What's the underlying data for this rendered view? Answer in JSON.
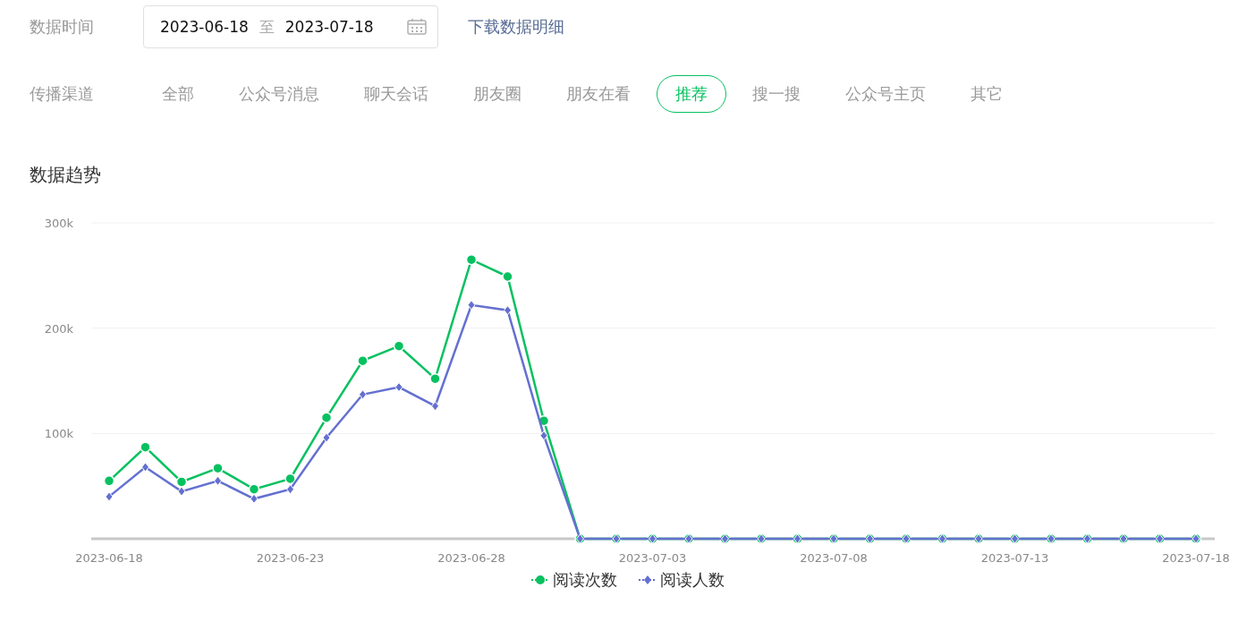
{
  "date_filter": {
    "label": "数据时间",
    "start": "2023-06-18",
    "separator": "至",
    "end": "2023-07-18",
    "download_link": "下载数据明细"
  },
  "channels": {
    "label": "传播渠道",
    "tabs": [
      {
        "label": "全部",
        "selected": false
      },
      {
        "label": "公众号消息",
        "selected": false
      },
      {
        "label": "聊天会话",
        "selected": false
      },
      {
        "label": "朋友圈",
        "selected": false
      },
      {
        "label": "朋友在看",
        "selected": false
      },
      {
        "label": "推荐",
        "selected": true
      },
      {
        "label": "搜一搜",
        "selected": false
      },
      {
        "label": "公众号主页",
        "selected": false
      },
      {
        "label": "其它",
        "selected": false
      }
    ]
  },
  "trend": {
    "title": "数据趋势",
    "chart_data": {
      "type": "line",
      "categories": [
        "2023-06-18",
        null,
        null,
        null,
        null,
        "2023-06-23",
        null,
        null,
        null,
        null,
        "2023-06-28",
        null,
        null,
        null,
        null,
        "2023-07-03",
        null,
        null,
        null,
        null,
        "2023-07-08",
        null,
        null,
        null,
        null,
        "2023-07-13",
        null,
        null,
        null,
        null,
        "2023-07-18"
      ],
      "legend": "bottom",
      "ylim": [
        0,
        300000
      ],
      "yticks": [
        {
          "value": 100000,
          "label": "100k"
        },
        {
          "value": 200000,
          "label": "200k"
        },
        {
          "value": 300000,
          "label": "300k"
        }
      ],
      "series": [
        {
          "name": "阅读次数",
          "color": "#07c160",
          "marker": "circle",
          "values": [
            55000,
            87000,
            54000,
            67000,
            47000,
            57000,
            115000,
            169000,
            183000,
            152000,
            265000,
            249000,
            112000,
            0,
            0,
            0,
            0,
            0,
            0,
            0,
            0,
            0,
            0,
            0,
            0,
            0,
            0,
            0,
            0,
            0,
            0
          ]
        },
        {
          "name": "阅读人数",
          "color": "#6470d0",
          "marker": "diamond",
          "values": [
            40000,
            68000,
            45000,
            55000,
            38000,
            47000,
            96000,
            137000,
            144000,
            126000,
            222000,
            217000,
            98000,
            0,
            0,
            0,
            0,
            0,
            0,
            0,
            0,
            0,
            0,
            0,
            0,
            0,
            0,
            0,
            0,
            0,
            0
          ]
        }
      ]
    }
  }
}
